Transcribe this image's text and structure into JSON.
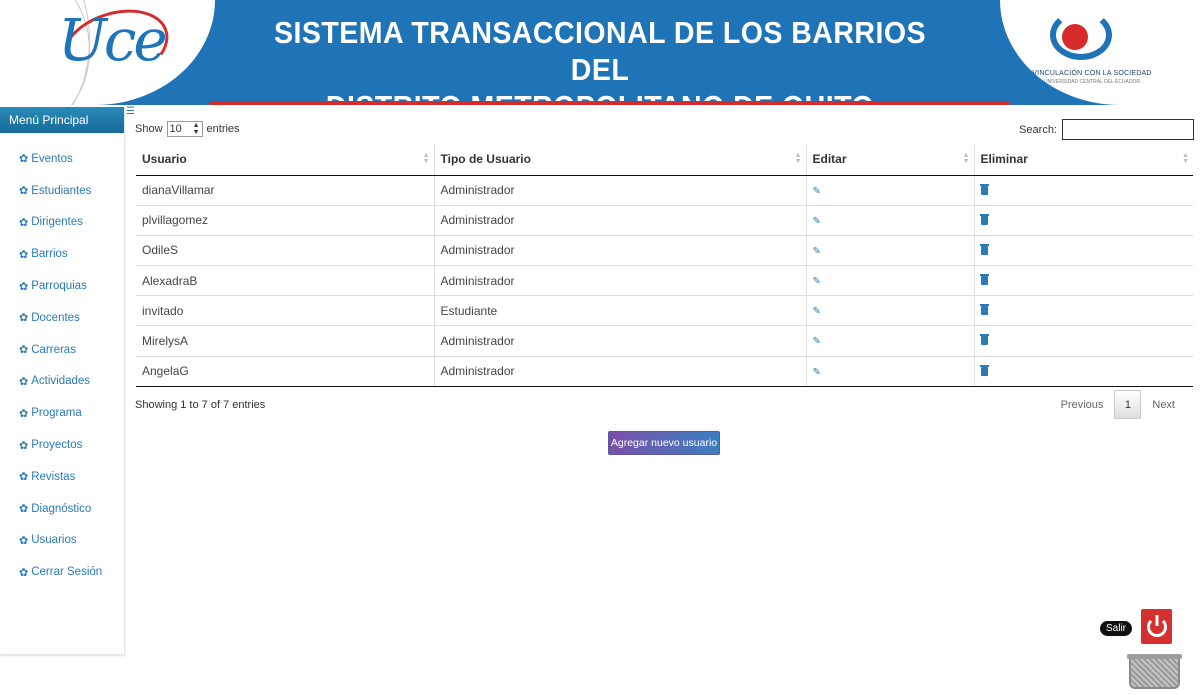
{
  "header": {
    "title_line1": "SISTEMA TRANSACCIONAL DE LOS BARRIOS DEL",
    "title_line2": "DISTRITO METROPOLITANO DE QUITO",
    "left_logo_text": "Uce",
    "right_logo_line1": "VINCULACIÓN CON LA SOCIEDAD",
    "right_logo_line2": "UNIVERSIDAD CENTRAL DEL ECUADOR",
    "brand_color": "#1f74b8",
    "accent_color": "#d62b2b"
  },
  "sidebar": {
    "title": "Menú Principal",
    "toggle_icon": "list-icon",
    "items": [
      {
        "label": "Eventos",
        "icon": "gear-icon"
      },
      {
        "label": "Estudiantes",
        "icon": "gear-icon"
      },
      {
        "label": "Dirigentes",
        "icon": "gear-icon"
      },
      {
        "label": "Barrios",
        "icon": "gear-icon"
      },
      {
        "label": "Parroquias",
        "icon": "gear-icon"
      },
      {
        "label": "Docentes",
        "icon": "gear-icon"
      },
      {
        "label": "Carreras",
        "icon": "gear-icon"
      },
      {
        "label": "Actividades",
        "icon": "gear-icon"
      },
      {
        "label": "Programa",
        "icon": "gear-icon"
      },
      {
        "label": "Proyectos",
        "icon": "gear-icon"
      },
      {
        "label": "Revistas",
        "icon": "gear-icon"
      },
      {
        "label": "Diagnóstico",
        "icon": "gear-icon"
      },
      {
        "label": "Usuarios",
        "icon": "gear-icon"
      },
      {
        "label": "Cerrar Sesión",
        "icon": "gear-icon"
      }
    ]
  },
  "table_controls": {
    "show_label": "Show",
    "length_value": "10",
    "entries_label": "entries",
    "search_label": "Search:",
    "search_value": ""
  },
  "table": {
    "columns": [
      "Usuario",
      "Tipo de Usuario",
      "Editar",
      "Eliminar"
    ],
    "rows": [
      {
        "usuario": "dianaVillamar",
        "tipo": "Administrador"
      },
      {
        "usuario": "plvillagomez",
        "tipo": "Administrador"
      },
      {
        "usuario": "OdileS",
        "tipo": "Administrador"
      },
      {
        "usuario": "AlexadraB",
        "tipo": "Administrador"
      },
      {
        "usuario": "invitado",
        "tipo": "Estudiante"
      },
      {
        "usuario": "MirelysA",
        "tipo": "Administrador"
      },
      {
        "usuario": "AngelaG",
        "tipo": "Administrador"
      }
    ]
  },
  "footer": {
    "info": "Showing 1 to 7 of 7 entries",
    "previous": "Previous",
    "current_page": "1",
    "next": "Next",
    "add_button": "Agregar nuevo usuario",
    "logout_label": "Salir"
  }
}
